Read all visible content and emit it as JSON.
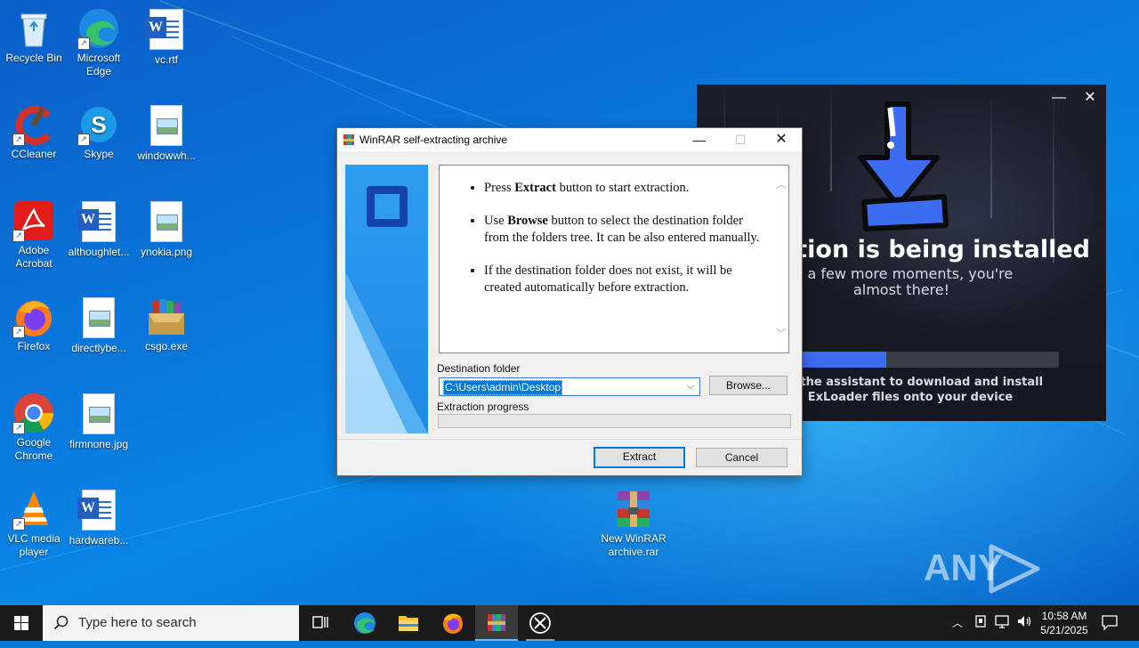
{
  "desktop": {
    "icons": [
      {
        "label": "Recycle Bin"
      },
      {
        "label": "Microsoft Edge"
      },
      {
        "label": "vc.rtf"
      },
      {
        "label": "CCleaner"
      },
      {
        "label": "Skype"
      },
      {
        "label": "windowwh..."
      },
      {
        "label": "Adobe Acrobat"
      },
      {
        "label": "althoughlet..."
      },
      {
        "label": "ynokia.png"
      },
      {
        "label": "Firefox"
      },
      {
        "label": "directlybe..."
      },
      {
        "label": "csgo.exe"
      },
      {
        "label": "Google Chrome"
      },
      {
        "label": "firmnone.jpg"
      },
      {
        "label": "VLC media player"
      },
      {
        "label": "hardwareb..."
      },
      {
        "label": "New WinRAR archive.rar"
      }
    ]
  },
  "winrar": {
    "title": "WinRAR self-extracting archive",
    "bullet1_pre": "Press ",
    "bullet1_bold": "Extract",
    "bullet1_post": " button to start extraction.",
    "bullet2_pre": "Use ",
    "bullet2_bold": "Browse",
    "bullet2_post": " button to select the destination folder from the folders tree. It can be also entered manually.",
    "bullet3": "If the destination folder does not exist, it will be created automatically before extraction.",
    "dest_label": "Destination folder",
    "dest_value": "C:\\Users\\admin\\Desktop",
    "browse_label": "Browse...",
    "progress_label": "Extraction progress",
    "progress": 0,
    "extract_label": "Extract",
    "cancel_label": "Cancel"
  },
  "exloader": {
    "title": "ation is being installed",
    "subtitle": "st a few more moments, you're\nalmost there!",
    "progress_percent": 33,
    "note": "for the assistant to download and install\nExLoader files onto your device"
  },
  "taskbar": {
    "search_placeholder": "Type here to search",
    "time": "10:58 AM",
    "date": "5/21/2025"
  },
  "watermark": {
    "text": "ANY RUN"
  },
  "colors": {
    "accent": "#0078d7",
    "exloader_progress": "#3c6cf0",
    "taskbar": "#1b1b1b"
  }
}
